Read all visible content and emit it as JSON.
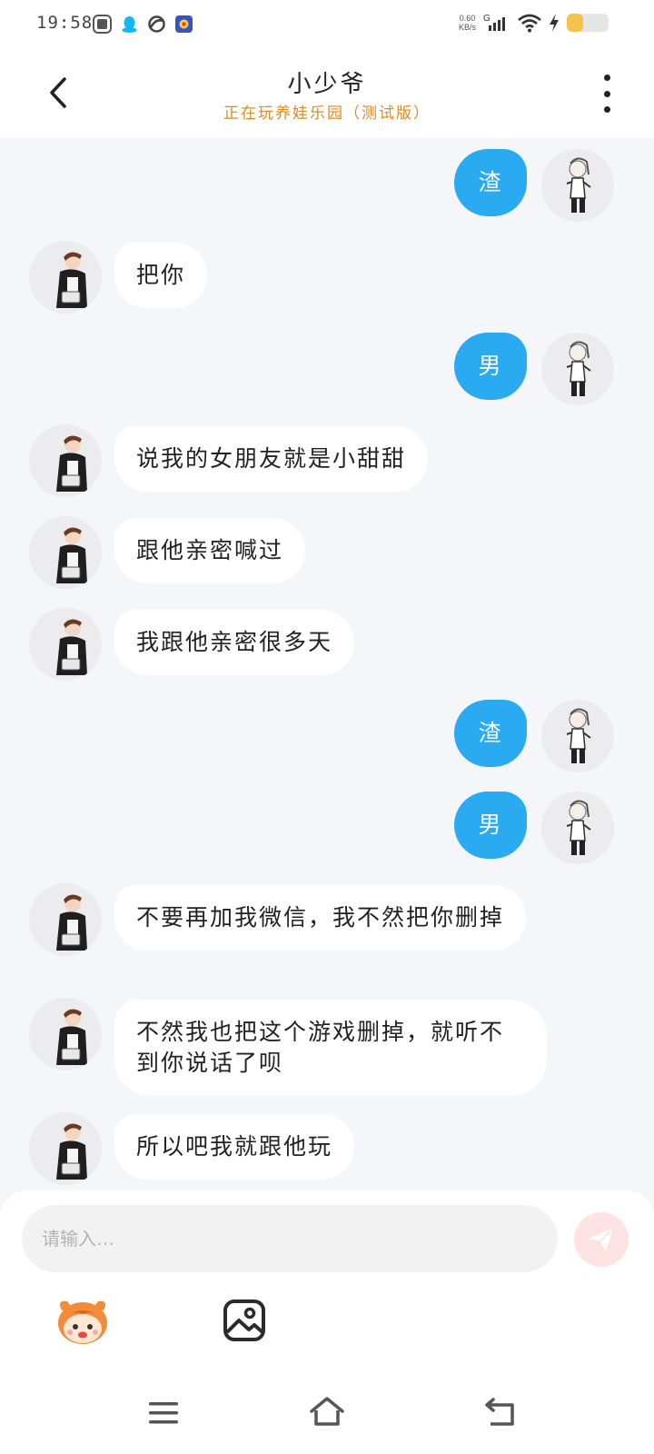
{
  "status_bar": {
    "time": "19:58",
    "net_speed_value": "0.60",
    "net_speed_unit": "KB/s",
    "network_type": "G",
    "battery_level": 0.4,
    "icons": [
      "app-icon",
      "qq-icon",
      "swirl-app-icon",
      "game-app-icon",
      "signal-icon",
      "wifi-icon",
      "charging-icon",
      "battery-icon"
    ]
  },
  "header": {
    "title": "小少爷",
    "subtitle": "正在玩养娃乐园（测试版）"
  },
  "messages": [
    {
      "side": "out",
      "text": "渣"
    },
    {
      "side": "in",
      "text": "把你"
    },
    {
      "side": "out",
      "text": "男"
    },
    {
      "side": "in",
      "text": "说我的女朋友就是小甜甜"
    },
    {
      "side": "in",
      "text": "跟他亲密喊过"
    },
    {
      "side": "in",
      "text": "我跟他亲密很多天"
    },
    {
      "side": "out",
      "text": "渣"
    },
    {
      "side": "out",
      "text": "男"
    },
    {
      "side": "in",
      "text": "不要再加我微信，我不然把你删掉"
    },
    {
      "side": "in",
      "text": "不然我也把这个游戏删掉，就听不到你说话了呗"
    },
    {
      "side": "in",
      "text": "所以吧我就跟他玩"
    }
  ],
  "input": {
    "placeholder": "请输入…",
    "value": ""
  },
  "colors": {
    "outgoing_bubble": "#2aaaf0",
    "incoming_bubble": "#ffffff",
    "subtitle": "#e08a1e",
    "send_button": "#fde3e1",
    "background": "#f4f6f9"
  }
}
